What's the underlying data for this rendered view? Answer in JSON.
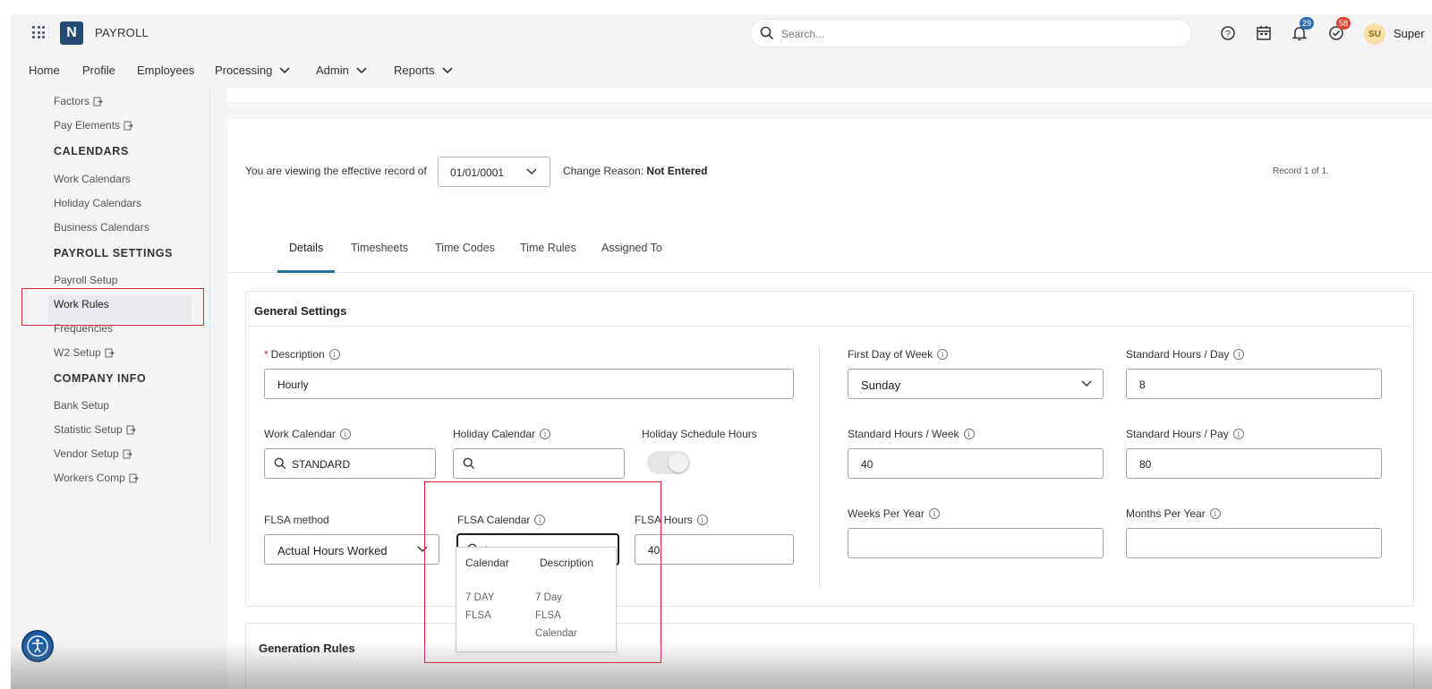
{
  "app": {
    "logo_letter": "N",
    "name": "PAYROLL"
  },
  "search": {
    "placeholder": "Search..."
  },
  "header": {
    "notifications_count": "29",
    "tasks_count": "58",
    "avatar_initials": "SU",
    "user_name": "Super",
    "badge_colors": {
      "notifications": "#2f6fb1",
      "tasks": "#e0452b"
    }
  },
  "nav": {
    "home": "Home",
    "profile": "Profile",
    "employees": "Employees",
    "processing": "Processing",
    "admin": "Admin",
    "reports": "Reports"
  },
  "sidebar": {
    "factors": "Factors",
    "pay_elements": "Pay Elements",
    "calendars_heading": "CALENDARS",
    "work_calendars": "Work Calendars",
    "holiday_calendars": "Holiday Calendars",
    "business_calendars": "Business Calendars",
    "payroll_settings_heading": "PAYROLL SETTINGS",
    "payroll_setup": "Payroll Setup",
    "work_rules": "Work Rules",
    "frequencies": "Frequencies",
    "w2_setup": "W2 Setup",
    "company_info_heading": "COMPANY INFO",
    "bank_setup": "Bank Setup",
    "statistic_setup": "Statistic Setup",
    "vendor_setup": "Vendor Setup",
    "workers_comp": "Workers Comp"
  },
  "record": {
    "viewing_text": "You are viewing the effective record of",
    "effective_date": "01/01/0001",
    "change_reason_label": "Change Reason:",
    "change_reason_value": "Not Entered",
    "record_info": "Record 1 of 1."
  },
  "tabs": [
    "Details",
    "Timesheets",
    "Time Codes",
    "Time Rules",
    "Assigned To"
  ],
  "general": {
    "title": "General Settings",
    "description_label": "Description",
    "description_value": "Hourly",
    "work_calendar_label": "Work Calendar",
    "work_calendar_value": "STANDARD",
    "holiday_calendar_label": "Holiday Calendar",
    "holiday_calendar_value": "",
    "holiday_schedule_hours_label": "Holiday Schedule Hours",
    "flsa_method_label": "FLSA method",
    "flsa_method_value": "Actual Hours Worked",
    "flsa_calendar_label": "FLSA Calendar",
    "flsa_calendar_value": "|",
    "flsa_hours_label": "FLSA Hours",
    "flsa_hours_value": "40",
    "first_day_label": "First Day of Week",
    "first_day_value": "Sunday",
    "std_hours_day_label": "Standard Hours / Day",
    "std_hours_day_value": "8",
    "std_hours_week_label": "Standard Hours / Week",
    "std_hours_week_value": "40",
    "std_hours_pay_label": "Standard Hours / Pay",
    "std_hours_pay_value": "80",
    "weeks_per_year_label": "Weeks Per Year",
    "months_per_year_label": "Months Per Year"
  },
  "flsa_dropdown": {
    "col_calendar": "Calendar",
    "col_description": "Description",
    "row_calendar_1": "7 DAY",
    "row_calendar_2": "FLSA",
    "row_desc_1": "7 Day",
    "row_desc_2": "FLSA",
    "row_desc_3": "Calendar"
  },
  "generation": {
    "title": "Generation Rules"
  },
  "colors": {
    "accent": "#2a6f97",
    "highlight": "#e0272f",
    "logo": "#244a74"
  }
}
